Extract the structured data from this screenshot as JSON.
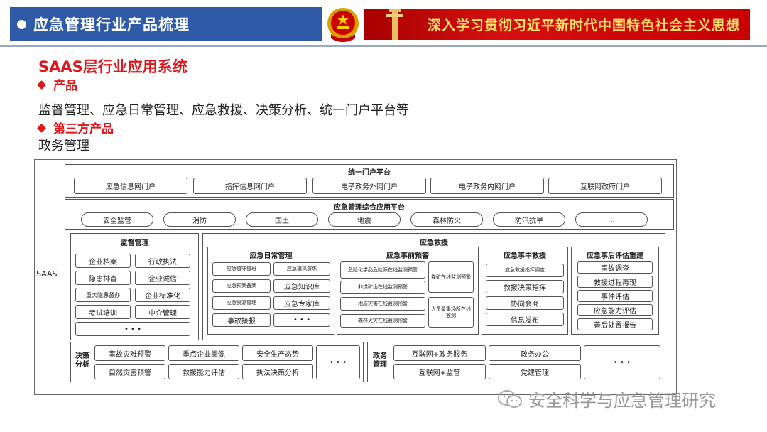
{
  "header": {
    "title": "应急管理行业产品梳理",
    "banner": "深入学习贯彻习近平新时代中国特色社会主义思想"
  },
  "content": {
    "heading": "SAAS层行业应用系统",
    "sub1": "产品",
    "text1": "监督管理、应急日常管理、应急救援、决策分析、统一门户平台等",
    "sub2": "第三方产品",
    "text2": "政务管理"
  },
  "diagram": {
    "saas": "SAAS",
    "portal": {
      "title": "统一门户平台",
      "items": [
        "应急信息网门户",
        "指挥信息网门户",
        "电子政务外网门户",
        "电子政务内网门户",
        "互联网政府门户"
      ]
    },
    "platform": {
      "title": "应急管理综合应用平台",
      "items": [
        "安全监管",
        "消防",
        "国土",
        "地震",
        "森林防火",
        "防汛抗旱",
        "…"
      ]
    },
    "supervision": {
      "title": "监督管理",
      "items": [
        "企业档案",
        "行政执法",
        "隐患排查",
        "企业诚信",
        "重大隐患督办",
        "企业标准化",
        "考试培训",
        "中介管理",
        "• • •"
      ]
    },
    "rescue": {
      "title": "应急救援",
      "daily": {
        "title": "应急日常管理",
        "items": [
          "应急值守值班",
          "应急模拟演练",
          "应急预案备案",
          "应急知识库",
          "应急资源管理",
          "应急专家库",
          "事故接报",
          "• • •"
        ]
      },
      "pre": {
        "title": "应急事前预警",
        "items": [
          "危险化学品危险源在线监测预警",
          "非煤矿山在线监测预警",
          "地质灾害在线监测预警",
          "森林火灾在线监测预警",
          "煤矿在线监测预警",
          "人员聚集场所在线监测"
        ]
      },
      "mid": {
        "title": "应急事中救援",
        "items": [
          "应急救援指挥调度",
          "救援决策指挥",
          "协同会商",
          "信息发布"
        ]
      },
      "post": {
        "title": "应急事后评估重建",
        "items": [
          "事故调查",
          "救援过程再现",
          "事件评估",
          "应急能力评估",
          "善后处置报告"
        ]
      }
    },
    "decision": {
      "label": "决策\n分析",
      "items": [
        "事故灾难预警",
        "重点企业画像",
        "安全生产态势",
        "自然灾害预警",
        "救援能力评估",
        "执法决策分析",
        "• • •"
      ]
    },
    "gov": {
      "label": "政务\n管理",
      "items": [
        "互联网+政务服务",
        "政务办公",
        "互联网+监管",
        "党建管理",
        "• • •"
      ]
    }
  },
  "watermark": "安全科学与应急管理研究",
  "colors": {
    "title_bg": "#2e5aa8",
    "accent_red": "#e0161b",
    "banner_bg": "#c80000",
    "banner_text": "#ffe16b"
  }
}
